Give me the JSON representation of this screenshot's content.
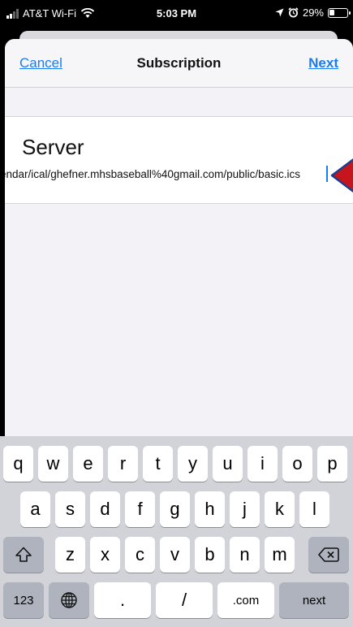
{
  "status_bar": {
    "carrier": "AT&T Wi-Fi",
    "time": "5:03 PM",
    "battery": "29%"
  },
  "nav": {
    "cancel_label": "Cancel",
    "title": "Subscription",
    "next_label": "Next"
  },
  "server": {
    "label": "Server",
    "value": "endar/ical/ghefner.mhsbaseball%40gmail.com/public/basic.ics"
  },
  "keyboard": {
    "row1": [
      "q",
      "w",
      "e",
      "r",
      "t",
      "y",
      "u",
      "i",
      "o",
      "p"
    ],
    "row2": [
      "a",
      "s",
      "d",
      "f",
      "g",
      "h",
      "j",
      "k",
      "l"
    ],
    "row3": [
      "z",
      "x",
      "c",
      "v",
      "b",
      "n",
      "m"
    ],
    "numbers_label": "123",
    "period_label": ".",
    "slash_label": "/",
    "dotcom_label": ".com",
    "next_label": "next"
  },
  "icons": {
    "shift": "shift-icon",
    "delete": "delete-icon",
    "globe": "globe-icon",
    "annotation": "red-arrow-marker",
    "wifi": "wifi-icon",
    "location": "location-arrow-icon",
    "alarm": "alarm-icon",
    "battery": "battery-icon"
  },
  "colors": {
    "accent": "#1a7cf5",
    "marker_fill": "#c4161c",
    "marker_outline": "#1d3d8f"
  }
}
